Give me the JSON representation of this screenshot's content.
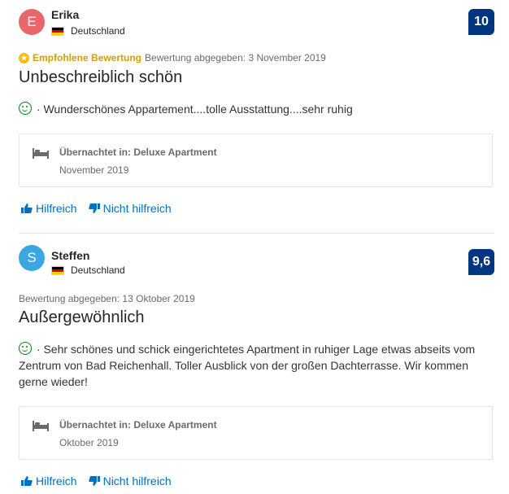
{
  "colors": {
    "score_bg": "#003580",
    "link": "#0071c2",
    "recommended": "#d4a000",
    "positive": "#008009"
  },
  "reviews": [
    {
      "avatar_letter": "E",
      "avatar_color": "#e9676b",
      "name": "Erika",
      "country": "Deutschland",
      "score": "10",
      "recommended_label": "Empfohlene Bewertung",
      "date": "Bewertung abgegeben: 3 November 2019",
      "title": "Unbeschreiblich schön",
      "positive": "· Wunderschönes Appartement....tolle Ausstattung....sehr ruhig",
      "stay_label": "Übernachtet in: Deluxe Apartment",
      "stay_date": "November 2019",
      "helpful": "Hilfreich",
      "not_helpful": "Nicht hilfreich"
    },
    {
      "avatar_letter": "S",
      "avatar_color": "#3ba7e2",
      "name": "Steffen",
      "country": "Deutschland",
      "score": "9,6",
      "date": "Bewertung abgegeben: 13 Oktober 2019",
      "title": "Außergewöhnlich",
      "positive": "· Sehr schönes und schick eingerichtetes Apartment in ruhiger Lage etwas abseits vom Zentrum von Bad Reichenhall. Toller Ausblick von der großen Dachterrasse. Wir kommen gerne wieder!",
      "stay_label": "Übernachtet in: Deluxe Apartment",
      "stay_date": "Oktober 2019",
      "helpful": "Hilfreich",
      "not_helpful": "Nicht hilfreich"
    }
  ]
}
